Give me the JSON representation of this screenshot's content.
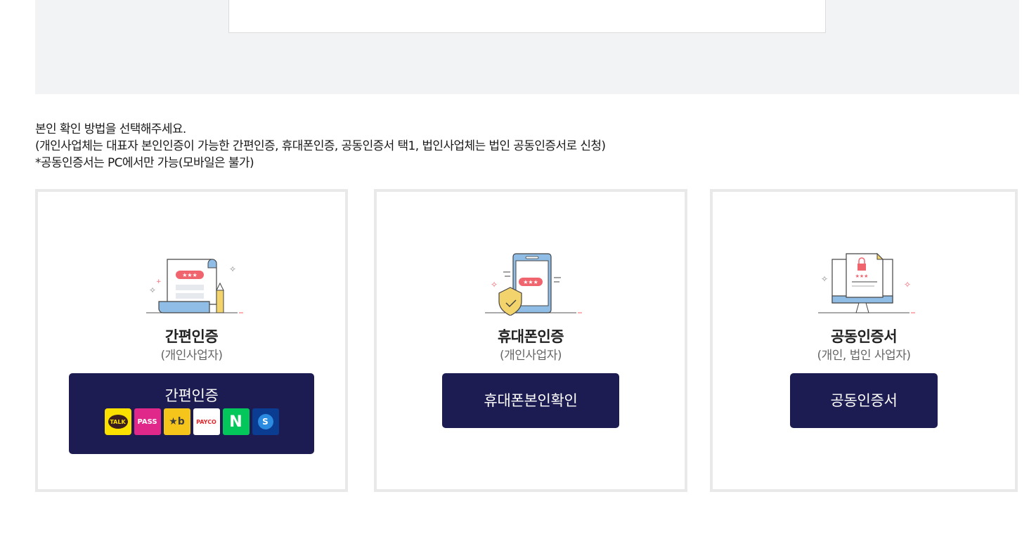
{
  "notice": {
    "line1": "본인 확인 방법을 선택해주세요.",
    "line2": "(개인사업체는 대표자 본인인증이 가능한 간편인증, 휴대폰인증, 공동인증서 택1, 법인사업체는 법인 공동인증서로 신청)",
    "line3": "*공동인증서는 PC에서만 가능(모바일은 불가)"
  },
  "cards": [
    {
      "title": "간편인증",
      "subtitle": "(개인사업자)",
      "button_label": "간편인증",
      "icon": "document-pencil-illustration",
      "logos": [
        {
          "name": "kakaotalk-logo",
          "text": "TALK",
          "bg": "#f9e000",
          "fg": "#3b1e1e"
        },
        {
          "name": "pass-logo",
          "text": "PASS",
          "bg": "#e0288a",
          "fg": "#ffffff"
        },
        {
          "name": "kb-logo",
          "text": "★b",
          "bg": "#f6c51c",
          "fg": "#3d3d3d"
        },
        {
          "name": "payco-logo",
          "text": "PAYCO",
          "bg": "#ffffff",
          "fg": "#e3262a"
        },
        {
          "name": "naver-logo",
          "text": "N",
          "bg": "#03c75a",
          "fg": "#ffffff"
        },
        {
          "name": "shinhan-logo",
          "text": "S",
          "bg": "#0a3d91",
          "fg": "#ffffff"
        }
      ]
    },
    {
      "title": "휴대폰인증",
      "subtitle": "(개인사업자)",
      "button_label": "휴대폰본인확인",
      "icon": "phone-shield-illustration"
    },
    {
      "title": "공동인증서",
      "subtitle": "(개인, 법인 사업자)",
      "button_label": "공동인증서",
      "icon": "monitor-certificate-illustration"
    }
  ],
  "colors": {
    "button_bg": "#1c1c52",
    "panel_bg": "#f2f3f5",
    "card_border": "#e9e9e9",
    "accent_red": "#f0646e",
    "illus_blue": "#8fbde6"
  }
}
